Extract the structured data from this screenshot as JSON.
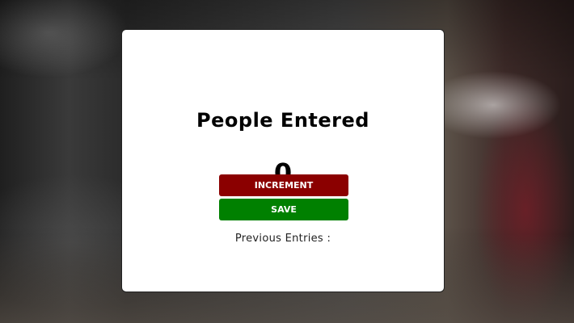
{
  "counter": {
    "title": "People Entered",
    "count": "0"
  },
  "buttons": {
    "increment_label": "INCREMENT",
    "save_label": "SAVE"
  },
  "entries": {
    "label": "Previous Entries :"
  },
  "colors": {
    "increment": "#8b0000",
    "save": "#008000",
    "card": "#ffffff"
  }
}
